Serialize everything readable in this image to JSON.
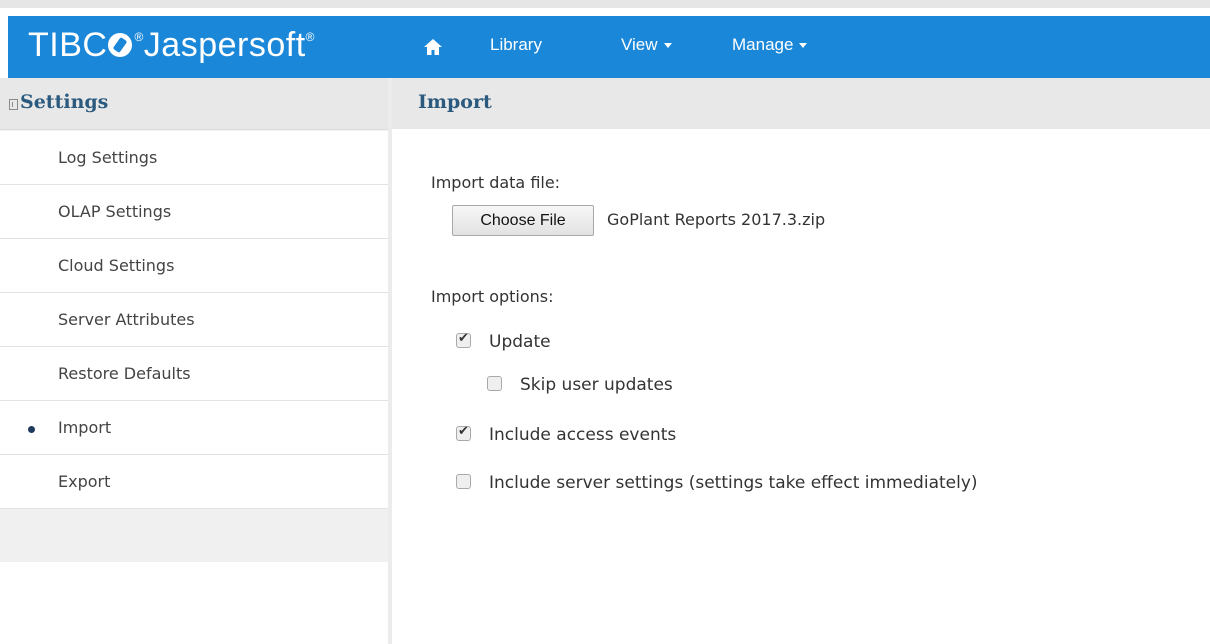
{
  "app": {
    "logo_text": "TIBC",
    "logo_text2": "Jaspersoft",
    "logo_tm": "®"
  },
  "nav": {
    "home_icon": "home-icon",
    "library": "Library",
    "view": "View",
    "manage": "Manage"
  },
  "sidebar": {
    "title": "Settings",
    "items": [
      {
        "label": "Log Settings"
      },
      {
        "label": "OLAP Settings"
      },
      {
        "label": "Cloud Settings"
      },
      {
        "label": "Server Attributes"
      },
      {
        "label": "Restore Defaults"
      },
      {
        "label": "Import",
        "selected": true
      },
      {
        "label": "Export"
      }
    ]
  },
  "main": {
    "title": "Import",
    "data_file_label": "Import data file:",
    "choose_file_label": "Choose File",
    "file_name": "GoPlant Reports 2017.3.zip",
    "options_label": "Import options:",
    "options": [
      {
        "label": "Update",
        "checked": true
      },
      {
        "label": "Skip user updates",
        "checked": false
      },
      {
        "label": "Include access events",
        "checked": true
      },
      {
        "label": "Include server settings (settings take effect immediately)",
        "checked": false
      }
    ]
  },
  "colors": {
    "navbar": "#1a87d9",
    "heading": "#2b5a7e"
  }
}
